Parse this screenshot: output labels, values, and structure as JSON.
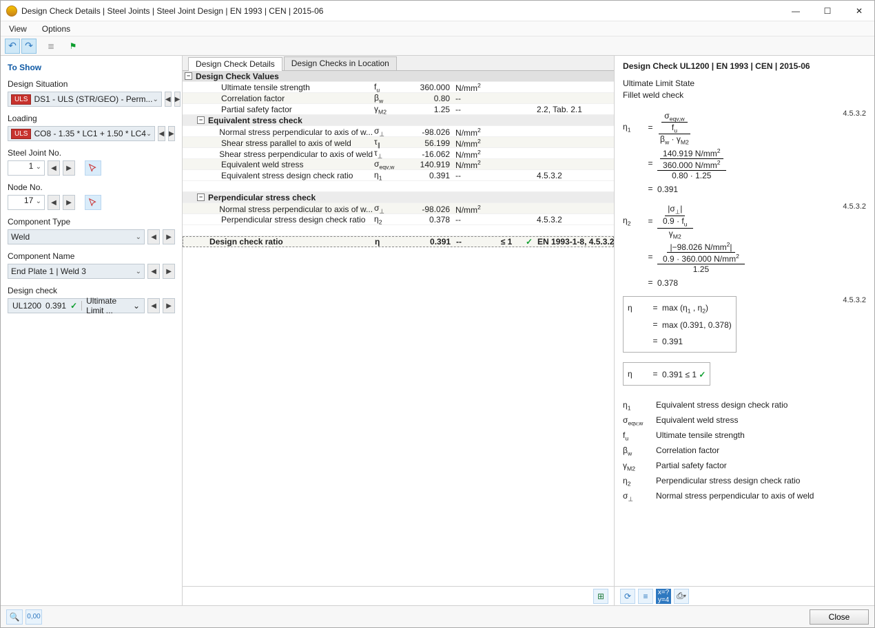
{
  "window": {
    "title": "Design Check Details | Steel Joints | Steel Joint Design | EN 1993 | CEN | 2015-06"
  },
  "menu": {
    "view": "View",
    "options": "Options"
  },
  "left": {
    "to_show": "To Show",
    "design_situation_lbl": "Design Situation",
    "design_situation_val": "DS1 - ULS (STR/GEO) - Perm...",
    "uls_tag": "ULS",
    "loading_lbl": "Loading",
    "loading_val": "CO8 - 1.35 * LC1 + 1.50 * LC4",
    "steel_joint_lbl": "Steel Joint No.",
    "steel_joint_val": "1",
    "node_lbl": "Node No.",
    "node_val": "17",
    "component_type_lbl": "Component Type",
    "component_type_val": "Weld",
    "component_name_lbl": "Component Name",
    "component_name_val": "End Plate 1 | Weld 3",
    "design_check_lbl": "Design check",
    "design_check_code": "UL1200",
    "design_check_ratio": "0.391",
    "design_check_name": "Ultimate Limit ..."
  },
  "tabs": {
    "details": "Design Check Details",
    "location": "Design Checks in Location"
  },
  "tree": {
    "g_values": "Design Check Values",
    "rows_values": [
      {
        "name": "Ultimate tensile strength",
        "sym": "f<sub>u</sub>",
        "val": "360.000",
        "unit": "N/mm<sup>2</sup>",
        "ref": ""
      },
      {
        "name": "Correlation factor",
        "sym": "β<sub>w</sub>",
        "val": "0.80",
        "unit": "--",
        "ref": ""
      },
      {
        "name": "Partial safety factor",
        "sym": "γ<sub>M2</sub>",
        "val": "1.25",
        "unit": "--",
        "ref": "2.2, Tab. 2.1"
      }
    ],
    "g_eq": "Equivalent stress check",
    "rows_eq": [
      {
        "name": "Normal stress perpendicular to axis of w...",
        "sym": "σ<sub>⊥</sub>",
        "val": "-98.026",
        "unit": "N/mm<sup>2</sup>",
        "ref": ""
      },
      {
        "name": "Shear stress parallel to axis of weld",
        "sym": "τ<sub>∥</sub>",
        "val": "56.199",
        "unit": "N/mm<sup>2</sup>",
        "ref": ""
      },
      {
        "name": "Shear stress perpendicular to axis of weld",
        "sym": "τ<sub>⊥</sub>",
        "val": "-16.062",
        "unit": "N/mm<sup>2</sup>",
        "ref": ""
      },
      {
        "name": "Equivalent weld stress",
        "sym": "σ<sub>eqv,w</sub>",
        "val": "140.919",
        "unit": "N/mm<sup>2</sup>",
        "ref": ""
      },
      {
        "name": "Equivalent stress design check ratio",
        "sym": "η<sub>1</sub>",
        "val": "0.391",
        "unit": "--",
        "ref": "4.5.3.2"
      }
    ],
    "g_perp": "Perpendicular stress check",
    "rows_perp": [
      {
        "name": "Normal stress perpendicular to axis of w...",
        "sym": "σ<sub>⊥</sub>",
        "val": "-98.026",
        "unit": "N/mm<sup>2</sup>",
        "ref": ""
      },
      {
        "name": "Perpendicular stress design check ratio",
        "sym": "η<sub>2</sub>",
        "val": "0.378",
        "unit": "--",
        "ref": "4.5.3.2"
      }
    ],
    "final": {
      "name": "Design check ratio",
      "sym": "η",
      "val": "0.391",
      "unit": "--",
      "le": "≤ 1",
      "ref": "EN 1993-1-8, 4.5.3.2"
    }
  },
  "right": {
    "title": "Design Check UL1200 | EN 1993 | CEN | 2015-06",
    "sub1": "Ultimate Limit State",
    "sub2": "Fillet weld check",
    "ref": "4.5.3.2",
    "eta1_frac1_num": "σ<sub>eqv,w</sub>",
    "eta1_frac1_den": "f<sub>u</sub>",
    "eta1_frac2_den": "β<sub>w</sub>  ·  γ<sub>M2</sub>",
    "eta1_val1_num": "140.919 N/mm<sup>2</sup>",
    "eta1_val1_den": "360.000 N/mm<sup>2</sup>",
    "eta1_val2_den": "0.80  ·  1.25",
    "eta1_res": "0.391",
    "eta2_frac1_num": "|σ<sub>⊥</sub>|",
    "eta2_frac1_den": "0.9  ·  f<sub>u</sub>",
    "eta2_frac2_den": "γ<sub>M2</sub>",
    "eta2_val1_num": "|−98.026 N/mm<sup>2</sup>|",
    "eta2_val1_den": "0.9  ·  360.000 N/mm<sup>2</sup>",
    "eta2_val2_den": "1.25",
    "eta2_res": "0.378",
    "eta_eq1": "max (η<sub>1</sub> ,  η<sub>2</sub>)",
    "eta_eq2": "max (0.391,  0.378)",
    "eta_res": "0.391",
    "eta_final": "0.391  ≤ 1",
    "eta1_sym": "η<sub>1</sub>",
    "eta2_sym": "η<sub>2</sub>",
    "eta_sym": "η",
    "glossary": [
      {
        "sym": "η<sub>1</sub>",
        "desc": "Equivalent stress design check ratio"
      },
      {
        "sym": "σ<sub>eqv,w</sub>",
        "desc": "Equivalent weld stress"
      },
      {
        "sym": "f<sub>u</sub>",
        "desc": "Ultimate tensile strength"
      },
      {
        "sym": "β<sub>w</sub>",
        "desc": "Correlation factor"
      },
      {
        "sym": "γ<sub>M2</sub>",
        "desc": "Partial safety factor"
      },
      {
        "sym": "η<sub>2</sub>",
        "desc": "Perpendicular stress design check ratio"
      },
      {
        "sym": "σ<sub>⊥</sub>",
        "desc": "Normal stress perpendicular to axis of weld"
      }
    ]
  },
  "footer": {
    "close": "Close"
  }
}
